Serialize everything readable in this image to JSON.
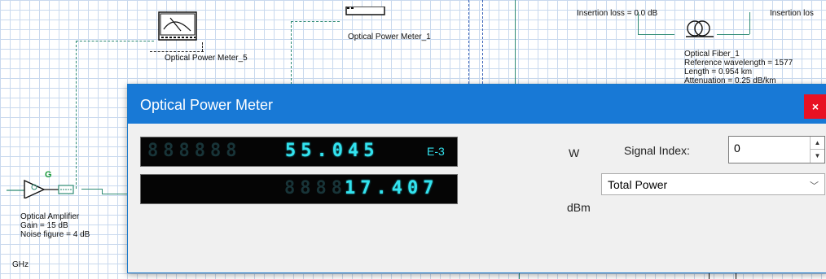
{
  "canvas": {
    "opm5_label": "Optical Power Meter_5",
    "opm1_label": "Optical Power Meter_1",
    "insertion_loss_left": "Insertion loss = 0.0  dB",
    "insertion_loss_right": "Insertion los",
    "fiber": {
      "name": "Optical Fiber_1",
      "ref_wavelength": "Reference wavelength = 1577",
      "length": "Length = 0.954  km",
      "attenuation_partial": "Attenuation = 0.25  dB/km"
    },
    "amplifier": {
      "name": "Optical Amplifier",
      "gain": "Gain = 15  dB",
      "noise": "Noise figure = 4  dB",
      "badge": "G"
    },
    "ghz_label": "GHz"
  },
  "dialog": {
    "title": "Optical Power Meter",
    "close_label": "×",
    "display_top": {
      "ghost": "888888",
      "value": "55.045",
      "exponent": "E-3"
    },
    "display_bottom": {
      "ghost": "8888",
      "value": "17.407"
    },
    "unit_top": "W",
    "unit_bottom": "dBm",
    "signal_index_label": "Signal Index:",
    "signal_index_value": "0",
    "power_select": "Total Power"
  }
}
